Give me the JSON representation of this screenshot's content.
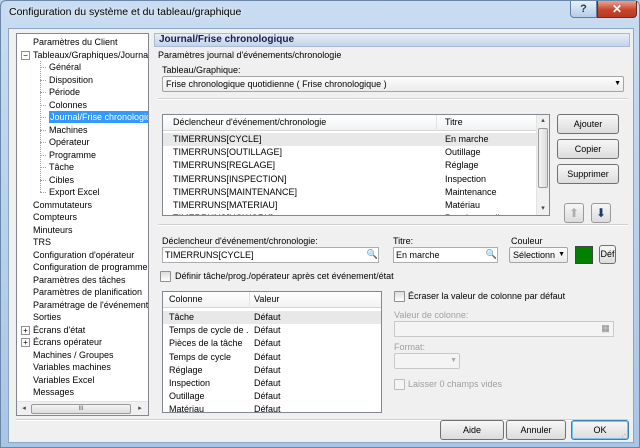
{
  "window": {
    "title": "Configuration du système et du tableau/graphique",
    "help_label": "?",
    "close_label": "✕"
  },
  "tree": {
    "items": [
      {
        "label": "Paramètres du Client",
        "level": 0,
        "expander": ""
      },
      {
        "label": "Tableaux/Graphiques/Journaux",
        "level": 0,
        "expander": "−"
      },
      {
        "label": "Général",
        "level": 1,
        "expander": ""
      },
      {
        "label": "Disposition",
        "level": 1,
        "expander": ""
      },
      {
        "label": "Période",
        "level": 1,
        "expander": ""
      },
      {
        "label": "Colonnes",
        "level": 1,
        "expander": ""
      },
      {
        "label": "Journal/Frise chronologique",
        "level": 1,
        "expander": "",
        "selected": true
      },
      {
        "label": "Machines",
        "level": 1,
        "expander": ""
      },
      {
        "label": "Opérateur",
        "level": 1,
        "expander": ""
      },
      {
        "label": "Programme",
        "level": 1,
        "expander": ""
      },
      {
        "label": "Tâche",
        "level": 1,
        "expander": ""
      },
      {
        "label": "Cibles",
        "level": 1,
        "expander": ""
      },
      {
        "label": "Export Excel",
        "level": 1,
        "expander": ""
      },
      {
        "label": "Commutateurs",
        "level": 0,
        "expander": ""
      },
      {
        "label": "Compteurs",
        "level": 0,
        "expander": ""
      },
      {
        "label": "Minuteurs",
        "level": 0,
        "expander": ""
      },
      {
        "label": "TRS",
        "level": 0,
        "expander": ""
      },
      {
        "label": "Configuration d'opérateur",
        "level": 0,
        "expander": ""
      },
      {
        "label": "Configuration de programme",
        "level": 0,
        "expander": ""
      },
      {
        "label": "Paramètres des tâches",
        "level": 0,
        "expander": ""
      },
      {
        "label": "Paramètres de planification",
        "level": 0,
        "expander": ""
      },
      {
        "label": "Paramétrage de l'événement",
        "level": 0,
        "expander": ""
      },
      {
        "label": "Sorties",
        "level": 0,
        "expander": ""
      },
      {
        "label": "Écrans d'état",
        "level": 0,
        "expander": "+"
      },
      {
        "label": "Écrans opérateur",
        "level": 0,
        "expander": "+"
      },
      {
        "label": "Machines / Groupes",
        "level": 0,
        "expander": ""
      },
      {
        "label": "Variables machines",
        "level": 0,
        "expander": ""
      },
      {
        "label": "Variables Excel",
        "level": 0,
        "expander": ""
      },
      {
        "label": "Messages",
        "level": 0,
        "expander": ""
      }
    ],
    "scroll_left": "◂",
    "scroll_right": "▸",
    "scroll_grip": "III"
  },
  "main": {
    "header": "Journal/Frise chronologique",
    "section_label": "Paramètres journal d'événements/chronologie",
    "chart_label": "Tableau/Graphique:",
    "chart_value": "Frise chronologique quotidienne  ( Frise chronologique )",
    "events_list": {
      "col1": "Déclencheur d'événement/chronologie",
      "col2": "Titre",
      "rows": [
        {
          "trigger": "TIMERRUNS[CYCLE]",
          "title": "En marche"
        },
        {
          "trigger": "TIMERRUNS[OUTILLAGE]",
          "title": "Outillage"
        },
        {
          "trigger": "TIMERRUNS[REGLAGE]",
          "title": "Réglage"
        },
        {
          "trigger": "TIMERRUNS[INSPECTION]",
          "title": "Inspection"
        },
        {
          "trigger": "TIMERRUNS[MAINTENANCE]",
          "title": "Maintenance"
        },
        {
          "trigger": "TIMERRUNS[MATERIAU]",
          "title": "Matériau"
        },
        {
          "trigger": "TIMERRUNS[NOWORK]",
          "title": "Pas de travail"
        }
      ]
    },
    "buttons": {
      "add": "Ajouter",
      "copy": "Copier",
      "delete": "Supprimer"
    },
    "trigger_label": "Déclencheur d'événement/chronologie:",
    "trigger_value": "TIMERRUNS[CYCLE]",
    "title_label": "Titre:",
    "title_value": "En marche",
    "color_label": "Couleur",
    "color_select": "Sélectionn",
    "color_value": "#008000",
    "default_button": "Déf",
    "define_checkbox": "Définir tâche/prog./opérateur après cet événement/état",
    "columns_list": {
      "col1": "Colonne",
      "col2": "Valeur",
      "rows": [
        {
          "column": "Tâche",
          "value": "Défaut"
        },
        {
          "column": "Temps de cycle de ...",
          "value": "Défaut"
        },
        {
          "column": "Pièces de la tâche",
          "value": "Défaut"
        },
        {
          "column": "Temps de cycle",
          "value": "Défaut"
        },
        {
          "column": "Réglage",
          "value": "Défaut"
        },
        {
          "column": "Inspection",
          "value": "Défaut"
        },
        {
          "column": "Outillage",
          "value": "Défaut"
        },
        {
          "column": "Matériau",
          "value": "Défaut"
        }
      ]
    },
    "overwrite_checkbox": "Écraser la valeur de colonne par défaut",
    "column_value_label": "Valeur de colonne:",
    "format_label": "Format:",
    "leave_empty_checkbox": "Laisser 0 champs vides"
  },
  "footer": {
    "help": "Aide",
    "cancel": "Annuler",
    "ok": "OK"
  }
}
